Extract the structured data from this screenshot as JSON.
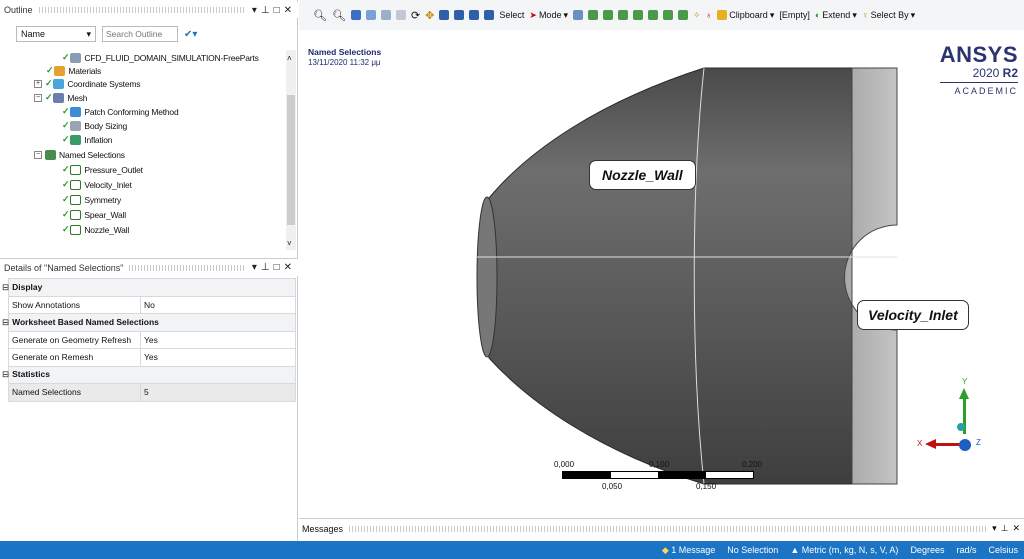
{
  "outline": {
    "title": "Outline",
    "column_name": "Name",
    "search_placeholder": "Search Outline",
    "tree": [
      {
        "label": "CFD_FLUID_DOMAIN_SIMULATION-FreeParts",
        "icon": "part-icon"
      },
      {
        "label": "Materials",
        "icon": "materials-icon"
      },
      {
        "label": "Coordinate Systems",
        "icon": "coordinate-systems-icon"
      },
      {
        "label": "Mesh",
        "icon": "mesh-icon"
      },
      {
        "label": "Patch Conforming Method",
        "icon": "method-icon"
      },
      {
        "label": "Body Sizing",
        "icon": "sizing-icon"
      },
      {
        "label": "Inflation",
        "icon": "inflation-icon"
      },
      {
        "label": "Named Selections",
        "icon": "named-selections-icon"
      },
      {
        "label": "Pressure_Outlet",
        "icon": "selection-icon"
      },
      {
        "label": "Velocity_Inlet",
        "icon": "selection-icon"
      },
      {
        "label": "Symmetry",
        "icon": "selection-icon"
      },
      {
        "label": "Spear_Wall",
        "icon": "selection-icon"
      },
      {
        "label": "Nozzle_Wall",
        "icon": "selection-icon"
      }
    ]
  },
  "details": {
    "title": "Details of \"Named Selections\"",
    "rows": [
      {
        "kind": "category",
        "label": "Display"
      },
      {
        "kind": "prop",
        "label": "Show Annotations",
        "value": "No"
      },
      {
        "kind": "category",
        "label": "Worksheet Based Named Selections"
      },
      {
        "kind": "prop",
        "label": "Generate on Geometry Refresh",
        "value": "Yes"
      },
      {
        "kind": "prop",
        "label": "Generate on Remesh",
        "value": "Yes"
      },
      {
        "kind": "category",
        "label": "Statistics"
      },
      {
        "kind": "prop",
        "label": "Named Selections",
        "value": "5"
      }
    ]
  },
  "toolbar": {
    "select_label": "Select",
    "mode_label": "Mode",
    "clipboard_label": "Clipboard",
    "empty_label": "[Empty]",
    "extend_label": "Extend",
    "select_by_label": "Select By"
  },
  "viewport": {
    "heading": "Named Selections",
    "timestamp": "13/11/2020 11:32 μμ",
    "brand": "ANSYS",
    "version_year": "2020",
    "version_release": "R2",
    "edition": "ACADEMIC",
    "label_nozzle": "Nozzle_Wall",
    "label_inlet": "Velocity_Inlet",
    "axis_x": "X",
    "axis_y": "Y",
    "axis_z": "Z",
    "scale_top": [
      "0,000",
      "0,100",
      "0,200 (m)"
    ],
    "scale_bottom": [
      "0,050",
      "0,150"
    ]
  },
  "messages": {
    "title": "Messages"
  },
  "status": {
    "message": "1 Message",
    "selection": "No Selection",
    "units": "Metric (m, kg, N, s, V, A)",
    "angle": "Degrees",
    "rot": "rad/s",
    "temp": "Celsius"
  },
  "colors": {
    "status_bar": "#1b74c4",
    "body": "#5a5a5a",
    "face": "#b9b9b9"
  }
}
